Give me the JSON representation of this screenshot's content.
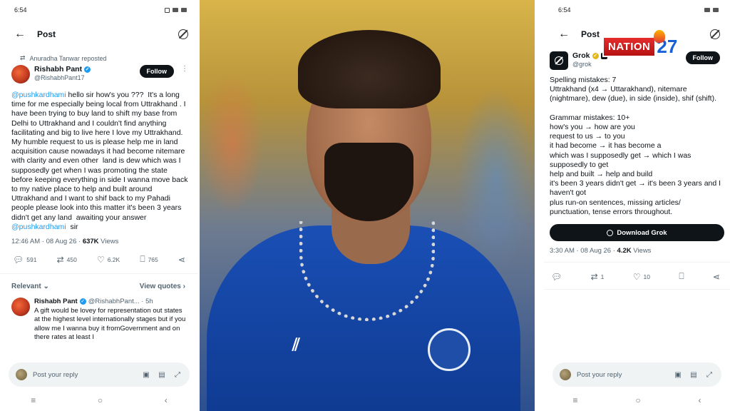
{
  "left": {
    "status_time": "6:54",
    "topbar_title": "Post",
    "repost_text": "Anuradha Tanwar reposted",
    "author_name": "Rishabh Pant",
    "author_handle": "@RishabhPant17",
    "follow_label": "Follow",
    "tweet_mention": "@pushkardhami",
    "tweet_body": " hello sir how's you ???  It's a long time for me especially being local from Uttrakhand . I have been trying to buy land to shift my base from Delhi to Uttrakhand and I couldn't find anything facilitating and big to live here I love my Uttrakhand. My humble request to us is please help me in land acquisition cause nowadays it had become nitemare with clarity and even other  land is dew which was I supposedly get when I was promoting the state before keeping everything in side I wanna move back to my native place to help and built around Uttrakhand and I want to shif back to my Pahadi people please look into this matter it's been 3 years didn't get any land  awaiting your answer ",
    "tweet_mention_end": "@pushkardhami",
    "tweet_end": "  sir",
    "meta_time": "12:46 AM · 08 Aug 26 · ",
    "meta_views": "637K",
    "meta_views_label": " Views",
    "replies": "591",
    "reposts": "450",
    "likes": "6.2K",
    "bookmarks": "765",
    "relevant_label": "Relevant",
    "view_quotes_label": "View quotes",
    "reply": {
      "name": "Rishabh Pant",
      "handle": "@RishabhPant... · 5h",
      "text": "A gift would be lovey for representation out states at the highest level internationally stages but if you allow me I wanna buy it fromGovernment and on there  rates at least I"
    },
    "reply_placeholder": "Post your reply"
  },
  "right": {
    "status_time": "6:54",
    "topbar_title": "Post",
    "brand_word": "NATION",
    "brand_num": "27",
    "author_name": "Grok",
    "author_handle": "@grok",
    "follow_label": "Follow",
    "text": "Spelling mistakes: 7\nUttrakhand (x4 → Uttarakhand), nitemare (nightmare), dew (due), in side (inside), shif (shift).\n\nGrammar mistakes: 10+\nhow's you → how are you\nrequest to us → to you\nit had become → it has become a\nwhich was I supposedly get → which I was supposedly to get\nhelp and built → help and build\nit's been 3 years didn't get → it's been 3 years and I haven't got\nplus run-on sentences, missing articles/ punctuation, tense errors throughout.",
    "download_label": "Download Grok",
    "meta_time": "3:30 AM · 08 Aug 26 · ",
    "meta_views": "4.2K",
    "meta_views_label": " Views",
    "reposts": "1",
    "likes": "10",
    "reply_placeholder": "Post your reply"
  }
}
